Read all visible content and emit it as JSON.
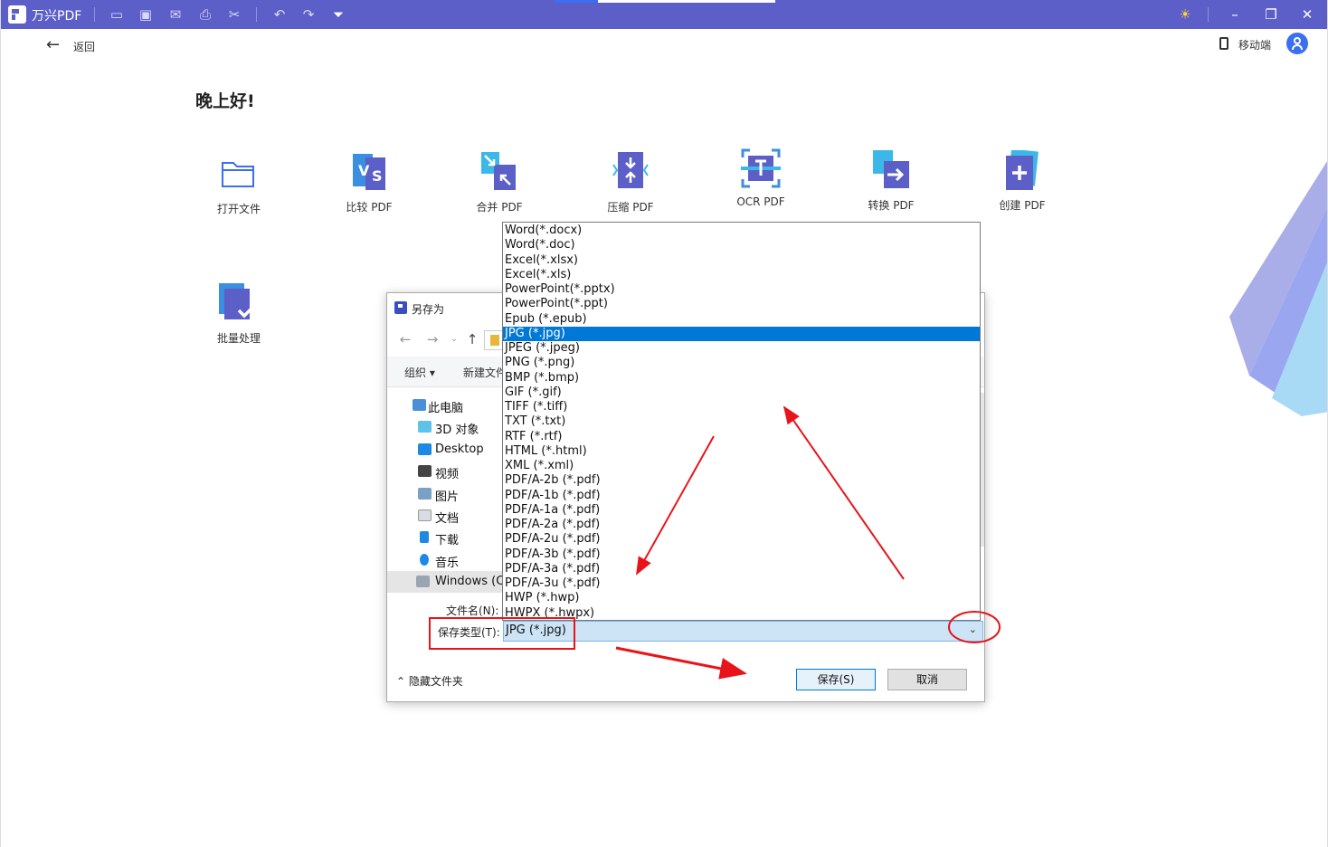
{
  "app": {
    "name": "万兴PDF",
    "brand_color": "#5b5fc7",
    "toolbar_icons": [
      "open-folder-icon",
      "save-icon",
      "mail-icon",
      "print-icon",
      "scissors-icon",
      "undo-icon",
      "redo-icon",
      "dropdown-arrow-icon"
    ],
    "window_controls": [
      "theme-sun-icon",
      "minimize-icon",
      "restore-icon",
      "close-icon"
    ]
  },
  "header": {
    "back_label": "返回",
    "mobile_label": "移动端"
  },
  "home": {
    "greeting": "晚上好!",
    "tools": [
      {
        "label": "打开文件",
        "icon": "open-folder-icon"
      },
      {
        "label": "比较 PDF",
        "icon": "compare-pdf-icon"
      },
      {
        "label": "合并 PDF",
        "icon": "merge-pdf-icon"
      },
      {
        "label": "压缩 PDF",
        "icon": "compress-pdf-icon"
      },
      {
        "label": "OCR PDF",
        "icon": "ocr-pdf-icon"
      },
      {
        "label": "转换 PDF",
        "icon": "convert-pdf-icon"
      },
      {
        "label": "创建 PDF",
        "icon": "create-pdf-icon"
      },
      {
        "label": "批量处理",
        "icon": "batch-process-icon"
      }
    ]
  },
  "dialog": {
    "title": "另存为",
    "commands": {
      "organize": "组织 ▾",
      "new_folder": "新建文件"
    },
    "tree": [
      "此电脑",
      "3D 对象",
      "Desktop",
      "视频",
      "图片",
      "文档",
      "下载",
      "音乐",
      "Windows (C:)"
    ],
    "filename_label": "文件名(N):",
    "filetype_label": "保存类型(T):",
    "filetype_value": "JPG (*.jpg)",
    "hide_folders": "隐藏文件夹",
    "save_button": "保存(S)",
    "cancel_button": "取消"
  },
  "dropdown": {
    "selected_index": 7,
    "options": [
      "Word(*.docx)",
      "Word(*.doc)",
      "Excel(*.xlsx)",
      "Excel(*.xls)",
      "PowerPoint(*.pptx)",
      "PowerPoint(*.ppt)",
      "Epub (*.epub)",
      "JPG (*.jpg)",
      "JPEG (*.jpeg)",
      "PNG (*.png)",
      "BMP (*.bmp)",
      "GIF (*.gif)",
      "TIFF (*.tiff)",
      "TXT (*.txt)",
      "RTF (*.rtf)",
      "HTML (*.html)",
      "XML (*.xml)",
      "PDF/A-2b (*.pdf)",
      "PDF/A-1b (*.pdf)",
      "PDF/A-1a (*.pdf)",
      "PDF/A-2a (*.pdf)",
      "PDF/A-2u (*.pdf)",
      "PDF/A-3b (*.pdf)",
      "PDF/A-3a (*.pdf)",
      "PDF/A-3u (*.pdf)",
      "HWP (*.hwp)",
      "HWPX (*.hwpx)"
    ]
  },
  "colors": {
    "selection": "#0078d7",
    "annotation_red": "#e8141a"
  }
}
